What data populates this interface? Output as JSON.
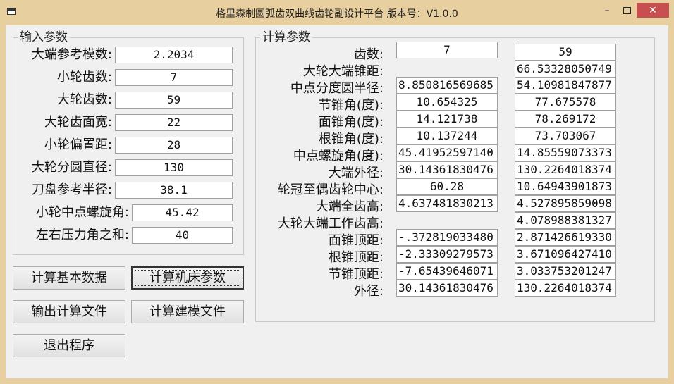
{
  "window": {
    "title": "格里森制圆弧齿双曲线齿轮副设计平台   版本号：V1.0.0",
    "minimize_glyph": "–",
    "close_glyph": "✕"
  },
  "input_group": {
    "title": "输入参数",
    "fields": [
      {
        "label": "大端参考模数:",
        "value": "2.2034"
      },
      {
        "label": "小轮齿数:",
        "value": "7"
      },
      {
        "label": "大轮齿数:",
        "value": "59"
      },
      {
        "label": "大轮齿面宽:",
        "value": "22"
      },
      {
        "label": "小轮偏置距:",
        "value": "28"
      },
      {
        "label": "大轮分圆直径:",
        "value": "130"
      },
      {
        "label": "刀盘参考半径:",
        "value": "38.1"
      },
      {
        "label": "小轮中点螺旋角:",
        "value": "45.42"
      },
      {
        "label": "左右压力角之和:",
        "value": "40"
      }
    ]
  },
  "buttons": {
    "calc_basic": "计算基本数据",
    "calc_machine": "计算机床参数",
    "output_file": "输出计算文件",
    "calc_model": "计算建模文件",
    "exit": "退出程序"
  },
  "calc_group": {
    "title": "计算参数",
    "rows": [
      {
        "label": "齿数:",
        "small": "7",
        "large": "59"
      },
      {
        "label": "大轮大端锥距:",
        "small": null,
        "large": "66.53328050749"
      },
      {
        "label": "中点分度圆半径:",
        "small": "8.850816569685",
        "large": "54.10981847877"
      },
      {
        "label": "节锥角(度):",
        "small": "10.654325",
        "large": "77.675578"
      },
      {
        "label": "面锥角(度):",
        "small": "14.121738",
        "large": "78.269172"
      },
      {
        "label": "根锥角(度):",
        "small": "10.137244",
        "large": "73.703067"
      },
      {
        "label": "中点螺旋角(度):",
        "small": "45.41952597140",
        "large": "14.85559073373"
      },
      {
        "label": "大端外径:",
        "small": "30.14361830476",
        "large": "130.2264018374"
      },
      {
        "label": "轮冠至偶齿轮中心:",
        "small": "60.28",
        "large": "10.64943901873"
      },
      {
        "label": "大端全齿高:",
        "small": "4.637481830213",
        "large": "4.527895859098"
      },
      {
        "label": "大轮大端工作齿高:",
        "small": null,
        "large": "4.078988381327"
      },
      {
        "label": "面锥顶距:",
        "small": "-.372819033480",
        "large": "2.871426619330"
      },
      {
        "label": "根锥顶距:",
        "small": "-2.33309279573",
        "large": "3.671096427410"
      },
      {
        "label": "节锥顶距:",
        "small": "-7.65439646071",
        "large": "3.033753201247"
      },
      {
        "label": "外径:",
        "small": "30.14361830476",
        "large": "130.2264018374"
      }
    ]
  }
}
